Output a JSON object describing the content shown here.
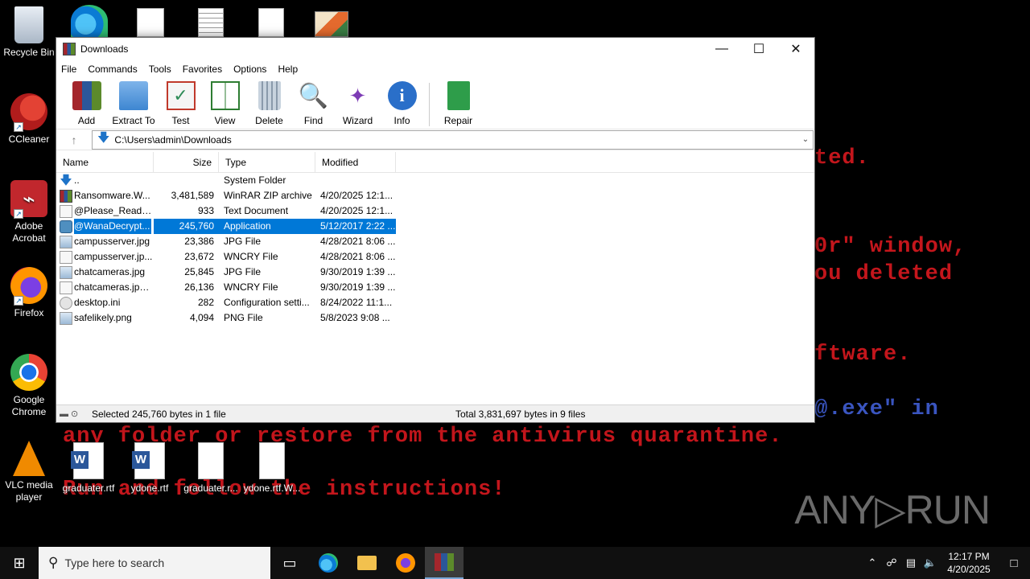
{
  "desktop": {
    "background_lines": [
      {
        "text": "ted."
      },
      {
        "text": "0r\" window,"
      },
      {
        "text": "ou deleted"
      },
      {
        "text": "ftware."
      },
      {
        "text": "@.exe\" in"
      },
      {
        "text": "any folder or restore from the antivirus quarantine."
      },
      {
        "text": "Run and follow the instructions!"
      }
    ],
    "icons": [
      {
        "label": "Recycle Bin",
        "icon": "recycle-bin-icon"
      },
      {
        "label": "CCleaner",
        "icon": "ccleaner-icon"
      },
      {
        "label": "Adobe Acrobat",
        "icon": "acrobat-icon"
      },
      {
        "label": "Firefox",
        "icon": "firefox-icon"
      },
      {
        "label": "Google Chrome",
        "icon": "chrome-icon"
      },
      {
        "label": "VLC media player",
        "icon": "vlc-icon"
      },
      {
        "label": "graduater.rtf",
        "icon": "word-doc-icon"
      },
      {
        "label": "ydone.rtf",
        "icon": "word-doc-icon"
      },
      {
        "label": "graduater.r...",
        "icon": "blank-file-icon"
      },
      {
        "label": "ydone.rtf.W...",
        "icon": "blank-file-icon"
      }
    ],
    "watermark": "ANY▷RUN"
  },
  "window": {
    "title": "Downloads",
    "menu": [
      "File",
      "Commands",
      "Tools",
      "Favorites",
      "Options",
      "Help"
    ],
    "toolbar": [
      {
        "label": "Add",
        "icon": "add-archive-icon"
      },
      {
        "label": "Extract To",
        "icon": "extract-folder-icon"
      },
      {
        "label": "Test",
        "icon": "test-clipboard-icon"
      },
      {
        "label": "View",
        "icon": "view-book-icon"
      },
      {
        "label": "Delete",
        "icon": "trash-icon"
      },
      {
        "label": "Find",
        "icon": "magnifier-icon"
      },
      {
        "label": "Wizard",
        "icon": "wizard-wand-icon"
      },
      {
        "label": "Info",
        "icon": "info-icon"
      },
      {
        "label": "Repair",
        "icon": "repair-kit-icon"
      }
    ],
    "address": "C:\\Users\\admin\\Downloads",
    "columns": {
      "name": "Name",
      "size": "Size",
      "type": "Type",
      "modified": "Modified"
    },
    "files": [
      {
        "name": "..",
        "size": "",
        "type": "System Folder",
        "modified": "",
        "icon": "up"
      },
      {
        "name": "Ransomware.W...",
        "size": "3,481,589",
        "type": "WinRAR ZIP archive",
        "modified": "4/20/2025 12:1...",
        "icon": "zip"
      },
      {
        "name": "@Please_Read_...",
        "size": "933",
        "type": "Text Document",
        "modified": "4/20/2025 12:1...",
        "icon": "txt"
      },
      {
        "name": "@WanaDecrypt...",
        "size": "245,760",
        "type": "Application",
        "modified": "5/12/2017 2:22 ...",
        "icon": "app",
        "selected": true
      },
      {
        "name": "campusserver.jpg",
        "size": "23,386",
        "type": "JPG File",
        "modified": "4/28/2021 8:06 ...",
        "icon": "img"
      },
      {
        "name": "campusserver.jp...",
        "size": "23,672",
        "type": "WNCRY File",
        "modified": "4/28/2021 8:06 ...",
        "icon": "blank"
      },
      {
        "name": "chatcameras.jpg",
        "size": "25,845",
        "type": "JPG File",
        "modified": "9/30/2019 1:39 ...",
        "icon": "img"
      },
      {
        "name": "chatcameras.jpg...",
        "size": "26,136",
        "type": "WNCRY File",
        "modified": "9/30/2019 1:39 ...",
        "icon": "blank"
      },
      {
        "name": "desktop.ini",
        "size": "282",
        "type": "Configuration setti...",
        "modified": "8/24/2022 11:1...",
        "icon": "ini"
      },
      {
        "name": "safelikely.png",
        "size": "4,094",
        "type": "PNG File",
        "modified": "5/8/2023 9:08 ...",
        "icon": "img"
      }
    ],
    "status_left": "Selected 245,760 bytes in 1 file",
    "status_right": "Total 3,831,697 bytes in 9 files"
  },
  "taskbar": {
    "search_placeholder": "Type here to search",
    "time": "12:17 PM",
    "date": "4/20/2025"
  }
}
